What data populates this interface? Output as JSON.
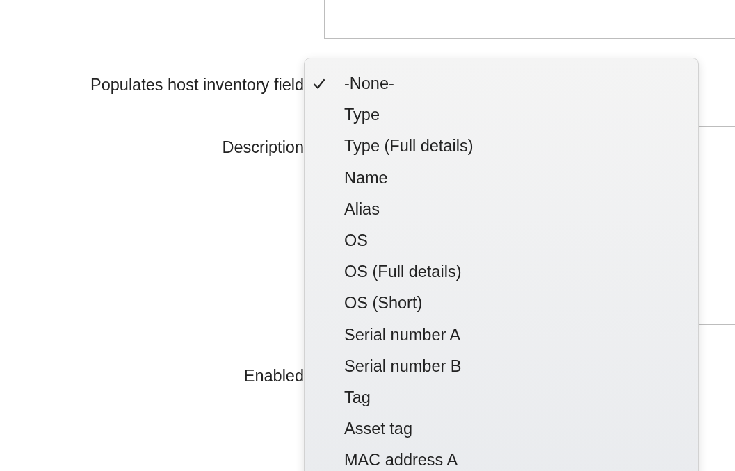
{
  "form": {
    "fields": [
      {
        "label": "Populates host inventory field",
        "kind": "select"
      },
      {
        "label": "Description",
        "kind": "textarea"
      },
      {
        "label": "Enabled",
        "kind": "checkbox"
      }
    ]
  },
  "dropdown_menu": {
    "options": [
      {
        "label": "-None-",
        "selected": true
      },
      {
        "label": "Type",
        "selected": false
      },
      {
        "label": "Type (Full details)",
        "selected": false
      },
      {
        "label": "Name",
        "selected": false
      },
      {
        "label": "Alias",
        "selected": false
      },
      {
        "label": "OS",
        "selected": false
      },
      {
        "label": "OS (Full details)",
        "selected": false
      },
      {
        "label": "OS (Short)",
        "selected": false
      },
      {
        "label": "Serial number A",
        "selected": false
      },
      {
        "label": "Serial number B",
        "selected": false
      },
      {
        "label": "Tag",
        "selected": false
      },
      {
        "label": "Asset tag",
        "selected": false
      },
      {
        "label": "MAC address A",
        "selected": false
      }
    ]
  }
}
